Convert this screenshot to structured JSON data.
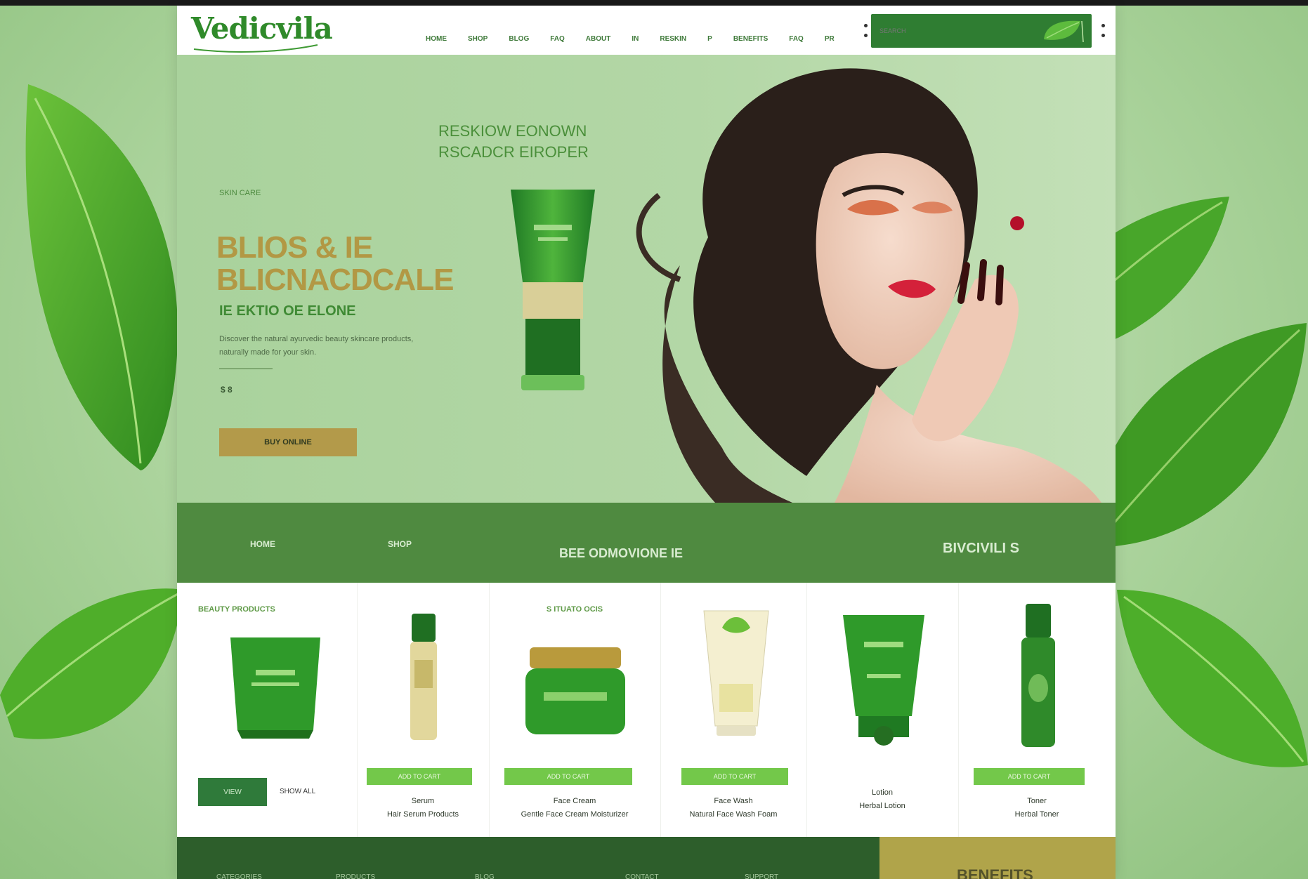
{
  "brand": {
    "logo": "Vedicvila"
  },
  "nav": {
    "items": [
      "HOME",
      "SHOP",
      "BLOG",
      "FAQ",
      "ABOUT",
      "IN",
      "RESKIN",
      "P",
      "BENEFITS",
      "FAQ",
      "PR"
    ]
  },
  "search": {
    "placeholder": "SEARCH"
  },
  "hero": {
    "eyebrow": "SKIN CARE",
    "title": "BLIOS & IE BLICNACDCALE",
    "subtitle": "IE EKTIO OE ELONE",
    "text": "Discover the natural ayurvedic beauty skincare products, naturally made for your skin.",
    "price": "$ 8",
    "button": "BUY ONLINE",
    "tagline": "RESKIOW EONOWN RSCADCR EIROPER"
  },
  "band": {
    "items": [
      "HOME",
      "SHOP",
      "BEE ODMOVIONE IE",
      "BIVCIVILI S"
    ]
  },
  "products": {
    "section_label": "BEAUTY PRODUCTS",
    "label_2": "S ITUATO OCIS",
    "view_button": "VIEW",
    "view_link": "SHOW ALL",
    "items": [
      {
        "button": "ADD TO CART",
        "name_1": "Serum",
        "name_2": "Hair Serum Products"
      },
      {
        "button": "ADD TO CART",
        "name_1": "Face Cream",
        "name_2": "Gentle Face Cream Moisturizer"
      },
      {
        "button": "ADD TO CART",
        "name_1": "Face Wash",
        "name_2": "Natural Face Wash Foam"
      },
      {
        "button": "",
        "name_1": "Lotion",
        "name_2": "Herbal Lotion"
      },
      {
        "button": "ADD TO CART",
        "name_1": "Toner",
        "name_2": "Herbal Toner"
      }
    ]
  },
  "footer": {
    "items": [
      "CATEGORIES",
      "PRODUCTS",
      "BLOG",
      "CONTACT",
      "SUPPORT"
    ],
    "highlight": "BENEFITS"
  },
  "colors": {
    "brand_green": "#2f8a2a",
    "band_green": "#4f8a40",
    "button_green": "#73c84a",
    "gold": "#b39a4a",
    "footer_green": "#2d5e2b"
  }
}
